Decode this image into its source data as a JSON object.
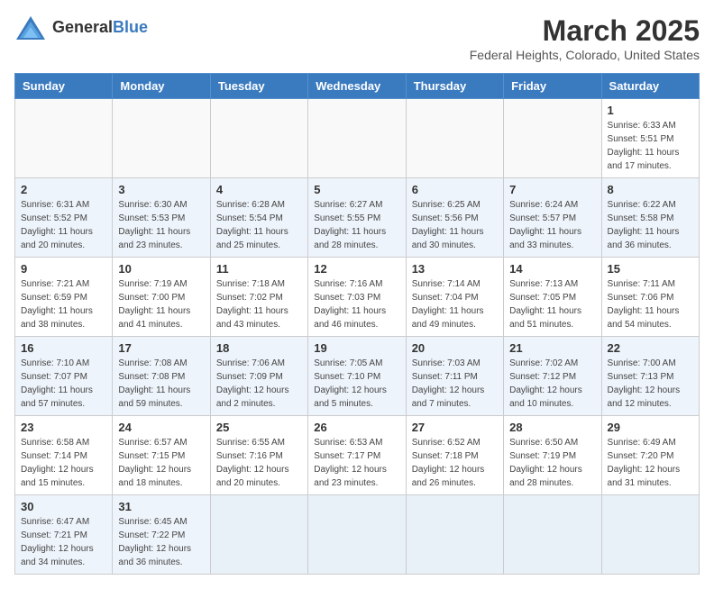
{
  "header": {
    "logo_general": "General",
    "logo_blue": "Blue",
    "month_title": "March 2025",
    "location": "Federal Heights, Colorado, United States"
  },
  "weekdays": [
    "Sunday",
    "Monday",
    "Tuesday",
    "Wednesday",
    "Thursday",
    "Friday",
    "Saturday"
  ],
  "weeks": [
    [
      {
        "day": "",
        "info": ""
      },
      {
        "day": "",
        "info": ""
      },
      {
        "day": "",
        "info": ""
      },
      {
        "day": "",
        "info": ""
      },
      {
        "day": "",
        "info": ""
      },
      {
        "day": "",
        "info": ""
      },
      {
        "day": "1",
        "info": "Sunrise: 6:33 AM\nSunset: 5:51 PM\nDaylight: 11 hours\nand 17 minutes."
      }
    ],
    [
      {
        "day": "2",
        "info": "Sunrise: 6:31 AM\nSunset: 5:52 PM\nDaylight: 11 hours\nand 20 minutes."
      },
      {
        "day": "3",
        "info": "Sunrise: 6:30 AM\nSunset: 5:53 PM\nDaylight: 11 hours\nand 23 minutes."
      },
      {
        "day": "4",
        "info": "Sunrise: 6:28 AM\nSunset: 5:54 PM\nDaylight: 11 hours\nand 25 minutes."
      },
      {
        "day": "5",
        "info": "Sunrise: 6:27 AM\nSunset: 5:55 PM\nDaylight: 11 hours\nand 28 minutes."
      },
      {
        "day": "6",
        "info": "Sunrise: 6:25 AM\nSunset: 5:56 PM\nDaylight: 11 hours\nand 30 minutes."
      },
      {
        "day": "7",
        "info": "Sunrise: 6:24 AM\nSunset: 5:57 PM\nDaylight: 11 hours\nand 33 minutes."
      },
      {
        "day": "8",
        "info": "Sunrise: 6:22 AM\nSunset: 5:58 PM\nDaylight: 11 hours\nand 36 minutes."
      }
    ],
    [
      {
        "day": "9",
        "info": "Sunrise: 7:21 AM\nSunset: 6:59 PM\nDaylight: 11 hours\nand 38 minutes."
      },
      {
        "day": "10",
        "info": "Sunrise: 7:19 AM\nSunset: 7:00 PM\nDaylight: 11 hours\nand 41 minutes."
      },
      {
        "day": "11",
        "info": "Sunrise: 7:18 AM\nSunset: 7:02 PM\nDaylight: 11 hours\nand 43 minutes."
      },
      {
        "day": "12",
        "info": "Sunrise: 7:16 AM\nSunset: 7:03 PM\nDaylight: 11 hours\nand 46 minutes."
      },
      {
        "day": "13",
        "info": "Sunrise: 7:14 AM\nSunset: 7:04 PM\nDaylight: 11 hours\nand 49 minutes."
      },
      {
        "day": "14",
        "info": "Sunrise: 7:13 AM\nSunset: 7:05 PM\nDaylight: 11 hours\nand 51 minutes."
      },
      {
        "day": "15",
        "info": "Sunrise: 7:11 AM\nSunset: 7:06 PM\nDaylight: 11 hours\nand 54 minutes."
      }
    ],
    [
      {
        "day": "16",
        "info": "Sunrise: 7:10 AM\nSunset: 7:07 PM\nDaylight: 11 hours\nand 57 minutes."
      },
      {
        "day": "17",
        "info": "Sunrise: 7:08 AM\nSunset: 7:08 PM\nDaylight: 11 hours\nand 59 minutes."
      },
      {
        "day": "18",
        "info": "Sunrise: 7:06 AM\nSunset: 7:09 PM\nDaylight: 12 hours\nand 2 minutes."
      },
      {
        "day": "19",
        "info": "Sunrise: 7:05 AM\nSunset: 7:10 PM\nDaylight: 12 hours\nand 5 minutes."
      },
      {
        "day": "20",
        "info": "Sunrise: 7:03 AM\nSunset: 7:11 PM\nDaylight: 12 hours\nand 7 minutes."
      },
      {
        "day": "21",
        "info": "Sunrise: 7:02 AM\nSunset: 7:12 PM\nDaylight: 12 hours\nand 10 minutes."
      },
      {
        "day": "22",
        "info": "Sunrise: 7:00 AM\nSunset: 7:13 PM\nDaylight: 12 hours\nand 12 minutes."
      }
    ],
    [
      {
        "day": "23",
        "info": "Sunrise: 6:58 AM\nSunset: 7:14 PM\nDaylight: 12 hours\nand 15 minutes."
      },
      {
        "day": "24",
        "info": "Sunrise: 6:57 AM\nSunset: 7:15 PM\nDaylight: 12 hours\nand 18 minutes."
      },
      {
        "day": "25",
        "info": "Sunrise: 6:55 AM\nSunset: 7:16 PM\nDaylight: 12 hours\nand 20 minutes."
      },
      {
        "day": "26",
        "info": "Sunrise: 6:53 AM\nSunset: 7:17 PM\nDaylight: 12 hours\nand 23 minutes."
      },
      {
        "day": "27",
        "info": "Sunrise: 6:52 AM\nSunset: 7:18 PM\nDaylight: 12 hours\nand 26 minutes."
      },
      {
        "day": "28",
        "info": "Sunrise: 6:50 AM\nSunset: 7:19 PM\nDaylight: 12 hours\nand 28 minutes."
      },
      {
        "day": "29",
        "info": "Sunrise: 6:49 AM\nSunset: 7:20 PM\nDaylight: 12 hours\nand 31 minutes."
      }
    ],
    [
      {
        "day": "30",
        "info": "Sunrise: 6:47 AM\nSunset: 7:21 PM\nDaylight: 12 hours\nand 34 minutes."
      },
      {
        "day": "31",
        "info": "Sunrise: 6:45 AM\nSunset: 7:22 PM\nDaylight: 12 hours\nand 36 minutes."
      },
      {
        "day": "",
        "info": ""
      },
      {
        "day": "",
        "info": ""
      },
      {
        "day": "",
        "info": ""
      },
      {
        "day": "",
        "info": ""
      },
      {
        "day": "",
        "info": ""
      }
    ]
  ]
}
